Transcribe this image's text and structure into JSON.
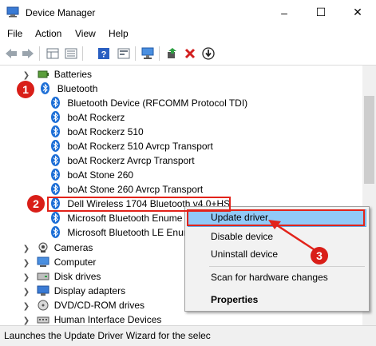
{
  "window": {
    "title": "Device Manager",
    "minimize": "–",
    "maximize": "☐",
    "close": "✕"
  },
  "menu": [
    "File",
    "Action",
    "View",
    "Help"
  ],
  "tree": {
    "batteries": "Batteries",
    "bluetooth": "Bluetooth",
    "bluetooth_children": [
      "Bluetooth Device (RFCOMM Protocol TDI)",
      "boAt Rockerz",
      "boAt Rockerz 510",
      "boAt Rockerz 510 Avrcp Transport",
      "boAt Rockerz Avrcp Transport",
      "boAt Stone 260",
      "boAt Stone 260 Avrcp Transport",
      "Dell Wireless 1704 Bluetooth v4.0+HS",
      "Microsoft Bluetooth Enume",
      "Microsoft Bluetooth LE Enur"
    ],
    "categories_after": [
      "Cameras",
      "Computer",
      "Disk drives",
      "Display adapters",
      "DVD/CD-ROM drives",
      "Human Interface Devices"
    ]
  },
  "context_menu": {
    "items": [
      "Update driver",
      "Disable device",
      "Uninstall device",
      "Scan for hardware changes",
      "Properties"
    ]
  },
  "annotations": [
    "1",
    "2",
    "3"
  ],
  "status": "Launches the Update Driver Wizard for the selec",
  "colors": {
    "annotation_red": "#e2231a",
    "highlight_blue": "#91c9f7",
    "bluetooth_blue": "#1c6ed6"
  }
}
